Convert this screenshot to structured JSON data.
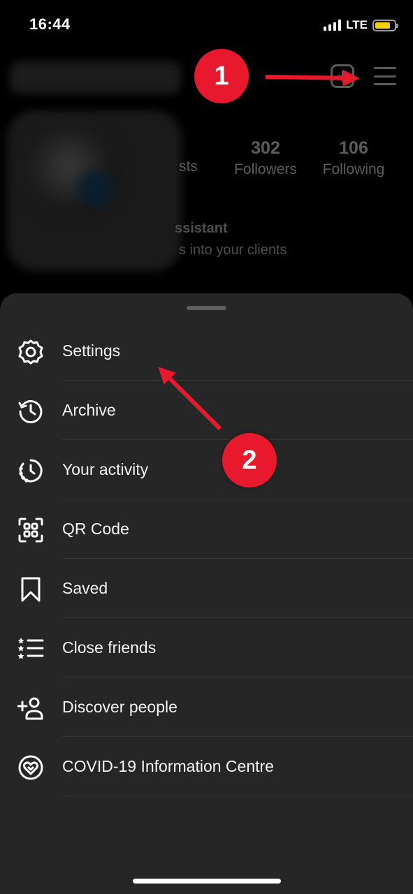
{
  "status_bar": {
    "time": "16:44",
    "network": "LTE",
    "battery_color": "#f5d000"
  },
  "profile": {
    "posts_label_fragment": "sts",
    "followers_count": "302",
    "followers_label": "Followers",
    "following_count": "106",
    "following_label": "Following",
    "bio_line1": "ssistant",
    "bio_line2": "s into your clients"
  },
  "annotations": {
    "badge1": "1",
    "badge2": "2",
    "color": "#e8192c"
  },
  "menu": {
    "items": [
      {
        "label": "Settings",
        "icon": "settings-gear-icon"
      },
      {
        "label": "Archive",
        "icon": "archive-history-icon"
      },
      {
        "label": "Your activity",
        "icon": "activity-clock-icon"
      },
      {
        "label": "QR Code",
        "icon": "qr-code-icon"
      },
      {
        "label": "Saved",
        "icon": "bookmark-icon"
      },
      {
        "label": "Close friends",
        "icon": "close-friends-list-icon"
      },
      {
        "label": "Discover people",
        "icon": "add-person-icon"
      },
      {
        "label": "COVID-19 Information Centre",
        "icon": "covid-heart-icon"
      }
    ]
  }
}
